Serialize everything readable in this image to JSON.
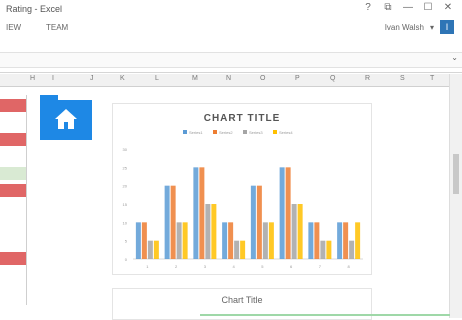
{
  "window": {
    "title": "Rating - Excel",
    "controls": [
      "?",
      "⧉",
      "—",
      "☐",
      "✕"
    ]
  },
  "ribbon": {
    "tabs": [
      "IEW",
      "TEAM"
    ],
    "user_name": "Ivan Walsh",
    "user_caret": "▾",
    "user_initial": "I"
  },
  "formula_bar": {
    "chevron": "⌄"
  },
  "columns": [
    "H",
    "I",
    "J",
    "K",
    "L",
    "M",
    "N",
    "O",
    "P",
    "Q",
    "R",
    "S",
    "T"
  ],
  "icons": {
    "folder": "folder-icon",
    "home": "home-icon"
  },
  "colors": {
    "accent": "#1e88e5",
    "s1": "#5b9bd5",
    "s2": "#ed7d31",
    "s3": "#a5a5a5",
    "s4": "#ffc000",
    "row_red": "#e06666",
    "row_green": "#d9ead3"
  },
  "left_rows": [
    "red",
    "white",
    "red",
    "white",
    "green",
    "red",
    "white",
    "white",
    "white",
    "red"
  ],
  "chart_data": [
    {
      "type": "bar",
      "title": "CHART TITLE",
      "categories": [
        "1",
        "2",
        "3",
        "4",
        "5",
        "6",
        "7",
        "8"
      ],
      "series": [
        {
          "name": "Series1",
          "values": [
            10,
            20,
            25,
            10,
            20,
            25,
            10,
            10
          ]
        },
        {
          "name": "Series2",
          "values": [
            10,
            20,
            25,
            10,
            20,
            25,
            10,
            10
          ]
        },
        {
          "name": "Series3",
          "values": [
            5,
            10,
            15,
            5,
            10,
            15,
            5,
            5
          ]
        },
        {
          "name": "Series4",
          "values": [
            5,
            10,
            15,
            5,
            10,
            15,
            5,
            10
          ]
        }
      ],
      "yticks": [
        "0",
        "5",
        "10",
        "15",
        "20",
        "25",
        "30"
      ],
      "ylim": [
        0,
        30
      ],
      "legend": "top",
      "grid": false
    },
    {
      "type": "bar",
      "title": "Chart Title"
    }
  ]
}
